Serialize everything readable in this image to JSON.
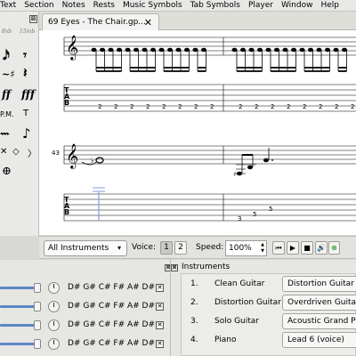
{
  "menubar": {
    "items": [
      "Text",
      "Section",
      "Notes",
      "Rests",
      "Music Symbols",
      "Tab Symbols",
      "Player",
      "Window",
      "Help"
    ]
  },
  "palette": {
    "close_glyph": "⊠",
    "hints": [
      "8vb",
      "15mb"
    ],
    "symbols": [
      "P.M.",
      "T"
    ]
  },
  "tab": {
    "label": "69 Eyes - The Chair.gp...",
    "close_glyph": "✕"
  },
  "score": {
    "system1": {
      "fret_numbers": [
        "2",
        "2",
        "2",
        "2",
        "2",
        "2",
        "2",
        "2",
        "2",
        "2",
        "2",
        "2",
        "2",
        "2",
        "2",
        "2"
      ]
    },
    "system2": {
      "bar_number": "43",
      "fret_numbers": [
        "3",
        "5",
        "5"
      ]
    }
  },
  "playbar": {
    "instrument_filter": "All Instruments",
    "voice_label": "Voice:",
    "voice_buttons": [
      "1",
      "2"
    ],
    "speed_label": "Speed:",
    "speed_value": "100%"
  },
  "mixer": {
    "close_glyph": "⊠",
    "rows": [
      {
        "tuning": "D# G# C# F# A# D#"
      },
      {
        "tuning": "D# G# C# F# A# D#"
      },
      {
        "tuning": "D# G# C# F# A# D#"
      },
      {
        "tuning": "D# G# C# F# A# D#"
      }
    ]
  },
  "instruments": {
    "close_glyph": "⊠",
    "title": "Instruments",
    "rows": [
      {
        "num": "1.",
        "name": "Clean Guitar",
        "patch": "Distortion Guitar"
      },
      {
        "num": "2.",
        "name": "Distortion Guitar",
        "patch": "Overdriven Guitar"
      },
      {
        "num": "3.",
        "name": "Solo Guitar",
        "patch": "Acoustic Grand Piano"
      },
      {
        "num": "4.",
        "name": "Piano",
        "patch": "Lead 6 (voice)"
      }
    ]
  },
  "colors": {
    "accent": "#5a87c6",
    "cursor": "#8a9be0",
    "play_green": "#2e9a2e"
  }
}
